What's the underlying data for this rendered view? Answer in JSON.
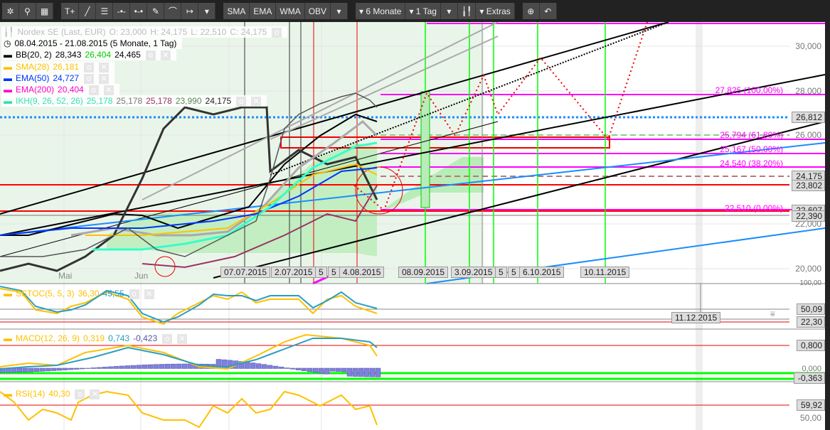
{
  "toolbar": {
    "groups": [
      [
        {
          "icon": "gear-icon",
          "label": "✲"
        },
        {
          "icon": "search-icon",
          "label": "⚲"
        },
        {
          "icon": "grid-icon",
          "label": "▦"
        }
      ],
      [
        {
          "icon": "text-add-icon",
          "label": "T+"
        },
        {
          "icon": "line-icon",
          "label": "╱"
        },
        {
          "icon": "fibonacci-icon",
          "label": "☰"
        },
        {
          "icon": "horizontal-line-icon",
          "label": "-•-"
        },
        {
          "icon": "horizontal-segment-icon",
          "label": "•-•"
        },
        {
          "icon": "pencil-icon",
          "label": "✎"
        },
        {
          "icon": "arc-icon",
          "label": "⌒"
        },
        {
          "icon": "measure-icon",
          "label": "↦"
        },
        {
          "icon": "dropdown-icon",
          "label": "▾"
        }
      ],
      [
        {
          "icon": "",
          "label": "SMA"
        },
        {
          "icon": "",
          "label": "EMA"
        },
        {
          "icon": "",
          "label": "WMA"
        },
        {
          "icon": "",
          "label": "OBV"
        },
        {
          "icon": "dropdown-icon",
          "label": "▾"
        }
      ],
      [
        {
          "icon": "dropdown-icon",
          "label": "▾ 6 Monate"
        },
        {
          "icon": "dropdown-icon",
          "label": "▾ 1 Tag"
        },
        {
          "icon": "dropdown-icon",
          "label": "▾"
        },
        {
          "icon": "candlestick-icon",
          "label": "╽╿"
        },
        {
          "icon": "dropdown-icon",
          "label": "▾ Extras"
        }
      ],
      [
        {
          "icon": "zoom-icon",
          "label": "⊕"
        },
        {
          "icon": "undo-icon",
          "label": "↶"
        }
      ]
    ]
  },
  "legend": {
    "instrument": "Nordex SE (Last, EUR)",
    "open": "O: 23,000",
    "high": "H: 24,175",
    "low": "L: 22,510",
    "close": "C: 24,175",
    "range": "08.04.2015 - 21.08.2015 (5 Monate, 1 Tag)",
    "bb": {
      "name": "BB(20, 2)",
      "v1": "28,343",
      "v2": "26,404",
      "v3": "24,465"
    },
    "sma": {
      "name": "SMA(28)",
      "v1": "26,181"
    },
    "ema50": {
      "name": "EMA(50)",
      "v1": "24,727"
    },
    "ema200": {
      "name": "EMA(200)",
      "v1": "20,404"
    },
    "ikh": {
      "name": "IKH(9, 26, 52, 26)",
      "v1": "25,178",
      "v2": "25,178",
      "v3": "25,178",
      "v4": "23,990",
      "v5": "24,175"
    }
  },
  "colors": {
    "bb": "#000000",
    "sma": "#ffc000",
    "ema50": "#0033ff",
    "ema200": "#ff00cc",
    "ikh": "#33ffcc",
    "fib": "#ff00ff"
  },
  "price_axis": [
    "30,000",
    "28,000",
    "26,000",
    "22,000",
    "20,000"
  ],
  "price_tags": [
    "26,812",
    "24,175",
    "23,802",
    "22,607",
    "22,390"
  ],
  "fib_levels": [
    "27,825 (100,00%)",
    "25,794 (61,80%)",
    "25,167 (50,00%)",
    "24,540 (38,20%)",
    "22,510 (0,00%)"
  ],
  "month_labels": [
    "Mai",
    "Jun"
  ],
  "date_tags": [
    "07.07.2015",
    "2.07.2015",
    "5",
    "5",
    "4.08.2015",
    "08.09.2015",
    "3.09.2015",
    "5",
    "5",
    "6.10.2015",
    "10.11.2015",
    "11.12.2015"
  ],
  "sstoc": {
    "name": "SSTOC(5, 5, 3)",
    "v1": "36,30",
    "v2": "45,55",
    "axis_top": "100,00",
    "tags": [
      "50,09",
      "22,30"
    ]
  },
  "macd": {
    "name": "MACD(12, 26, 9)",
    "v1": "0,319",
    "v2": "0,743",
    "v3": "-0,423",
    "axis": "0,000",
    "tags": [
      "0,800",
      "-0,363"
    ]
  },
  "rsi": {
    "name": "RSI(14)",
    "v1": "40,30",
    "axis": "50,00",
    "tags": [
      "59,92"
    ]
  }
}
